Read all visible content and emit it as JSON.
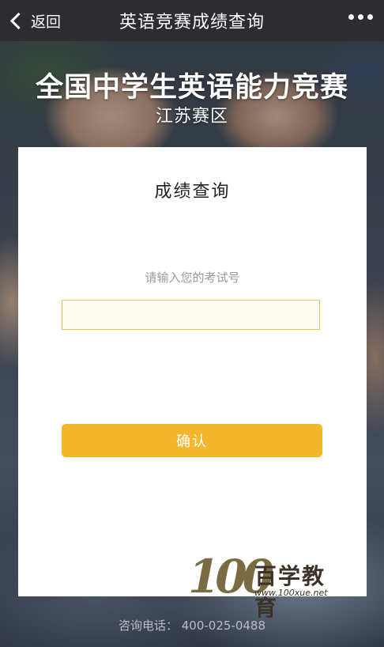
{
  "navbar": {
    "back_label": "返回",
    "title": "英语竞赛成绩查询"
  },
  "hero": {
    "title": "全国中学生英语能力竞赛",
    "subtitle": "江苏赛区"
  },
  "card": {
    "title": "成绩查询",
    "prompt": "请输入您的考试号",
    "input_value": "",
    "confirm_label": "确认"
  },
  "logo": {
    "number": "100",
    "name": "百学教育",
    "url": "www.100xue.net"
  },
  "footer": {
    "text": "咨询电话： 400-025-0488"
  },
  "colors": {
    "navbar_bg": "#2c2c31",
    "button_bg": "#f3b62d",
    "input_border": "#e6c25a"
  }
}
